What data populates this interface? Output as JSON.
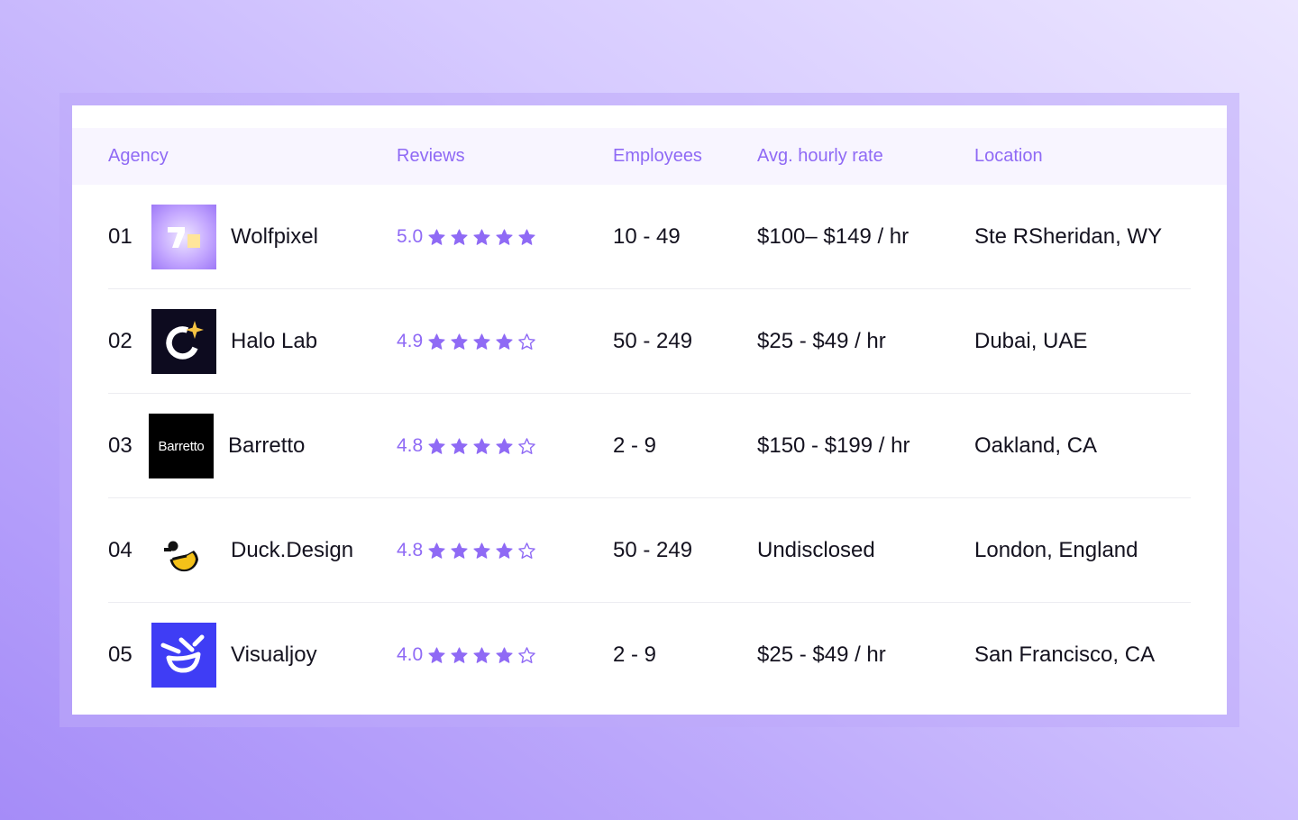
{
  "columns": {
    "agency": "Agency",
    "reviews": "Reviews",
    "employees": "Employees",
    "rate": "Avg. hourly rate",
    "location": "Location"
  },
  "colors": {
    "accent": "#8f6af5",
    "header_bg": "#f8f5ff",
    "text": "#14121f"
  },
  "agencies": [
    {
      "rank": "01",
      "name": "Wolfpixel",
      "logo_icon": "wolfpixel-logo",
      "score": "5.0",
      "stars": 5,
      "employees": "10 - 49",
      "rate": "$100– $149 / hr",
      "location": "Ste RSheridan, WY"
    },
    {
      "rank": "02",
      "name": "Halo Lab",
      "logo_icon": "halo-lab-logo",
      "score": "4.9",
      "stars": 4,
      "employees": "50 - 249",
      "rate": "$25 - $49 / hr",
      "location": "Dubai, UAE"
    },
    {
      "rank": "03",
      "name": "Barretto",
      "logo_icon": "barretto-logo",
      "logo_text": "Barretto",
      "score": "4.8",
      "stars": 4,
      "employees": "2 - 9",
      "rate": "$150 - $199 / hr",
      "location": "Oakland, CA"
    },
    {
      "rank": "04",
      "name": "Duck.Design",
      "logo_icon": "duck-design-logo",
      "score": "4.8",
      "stars": 4,
      "employees": "50 - 249",
      "rate": "Undisclosed",
      "location": "London, England"
    },
    {
      "rank": "05",
      "name": "Visualjoy",
      "logo_icon": "visualjoy-logo",
      "score": "4.0",
      "stars": 4,
      "employees": "2 - 9",
      "rate": "$25 - $49 / hr",
      "location": "San Francisco, CA"
    }
  ]
}
